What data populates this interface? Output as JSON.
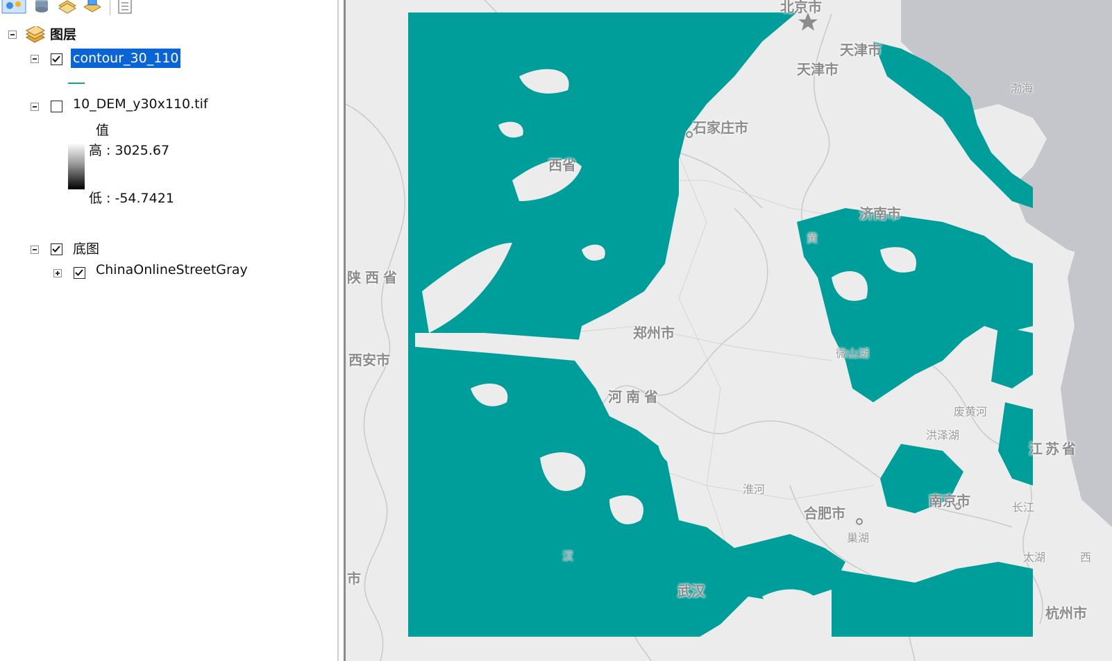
{
  "toc": {
    "layers_group_label": "图层",
    "layer_contour_label": "contour_30_110",
    "layer_dem_label": "10_DEM_y30x110.tif",
    "dem_legend": {
      "title": "值",
      "high_label": "高 : 3025.67",
      "low_label": "低 : -54.7421"
    },
    "basemap_group_label": "底图",
    "basemap_layer_label": "ChinaOnlineStreetGray",
    "checked": {
      "contour": true,
      "dem": false,
      "basemap_group": true,
      "basemap_layer": true
    }
  },
  "map": {
    "overlay_color": "#009e9a",
    "land_color": "#ececed",
    "sea_color": "#c5c6cb",
    "labels": {
      "beijing": "北京市",
      "tianjin1": "天津市",
      "tianjin2": "天津市",
      "bohai": "渤海",
      "shijiazhuang": "石家庄市",
      "shanxi_frag": "西省",
      "jinan": "济南市",
      "huang_frag": "黄",
      "shaanxi": "陕西省",
      "zhengzhou": "郑州市",
      "xian": "西安市",
      "weishan": "微山湖",
      "henan": "河南省",
      "feihuanghe": "废黄河",
      "hongze": "洪泽湖",
      "jiangsu": "江苏省",
      "huaihe": "淮河",
      "hefei": "合肥市",
      "nanjing": "南京市",
      "changjiang_frag": "长江",
      "chaohu": "巢湖",
      "taihu": "太湖",
      "shi_frag": "市",
      "wuhan": "武汉",
      "hangzhou": "杭州市",
      "han_frag": "汉",
      "xi_frag": "西"
    }
  }
}
